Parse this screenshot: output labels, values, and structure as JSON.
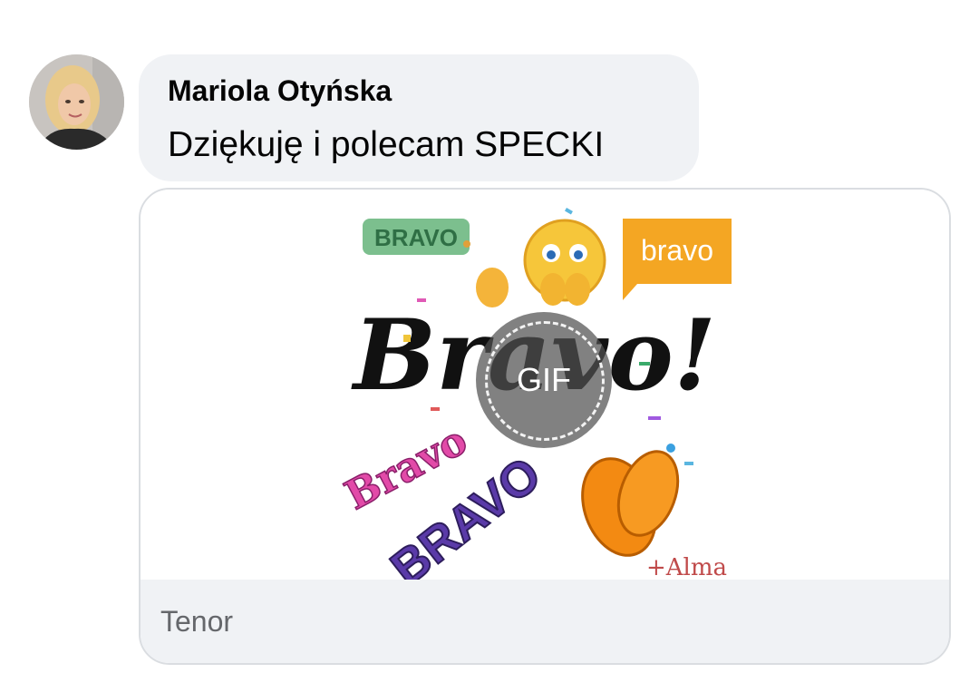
{
  "comment": {
    "author": "Mariola Otyńska",
    "text": "Dziękuję i polecam SPECKI"
  },
  "attachment": {
    "badge_label": "GIF",
    "source": "Tenor",
    "gif_words": {
      "bravo_green": "BRAVO",
      "bravo_orange": "bravo",
      "bravo_main": "Bravo!",
      "bravo_pink": "Bravo",
      "bravo_block": "BRAVO",
      "alma": "+Alma"
    }
  },
  "colors": {
    "bubble_bg": "#f0f2f5",
    "card_border": "#dadde1",
    "secondary_text": "#65676b",
    "primary_text": "#050505"
  },
  "icons": {
    "avatar": "profile-photo",
    "emoji": "clapping-face-emoji",
    "hands": "clapping-hands-icon"
  }
}
